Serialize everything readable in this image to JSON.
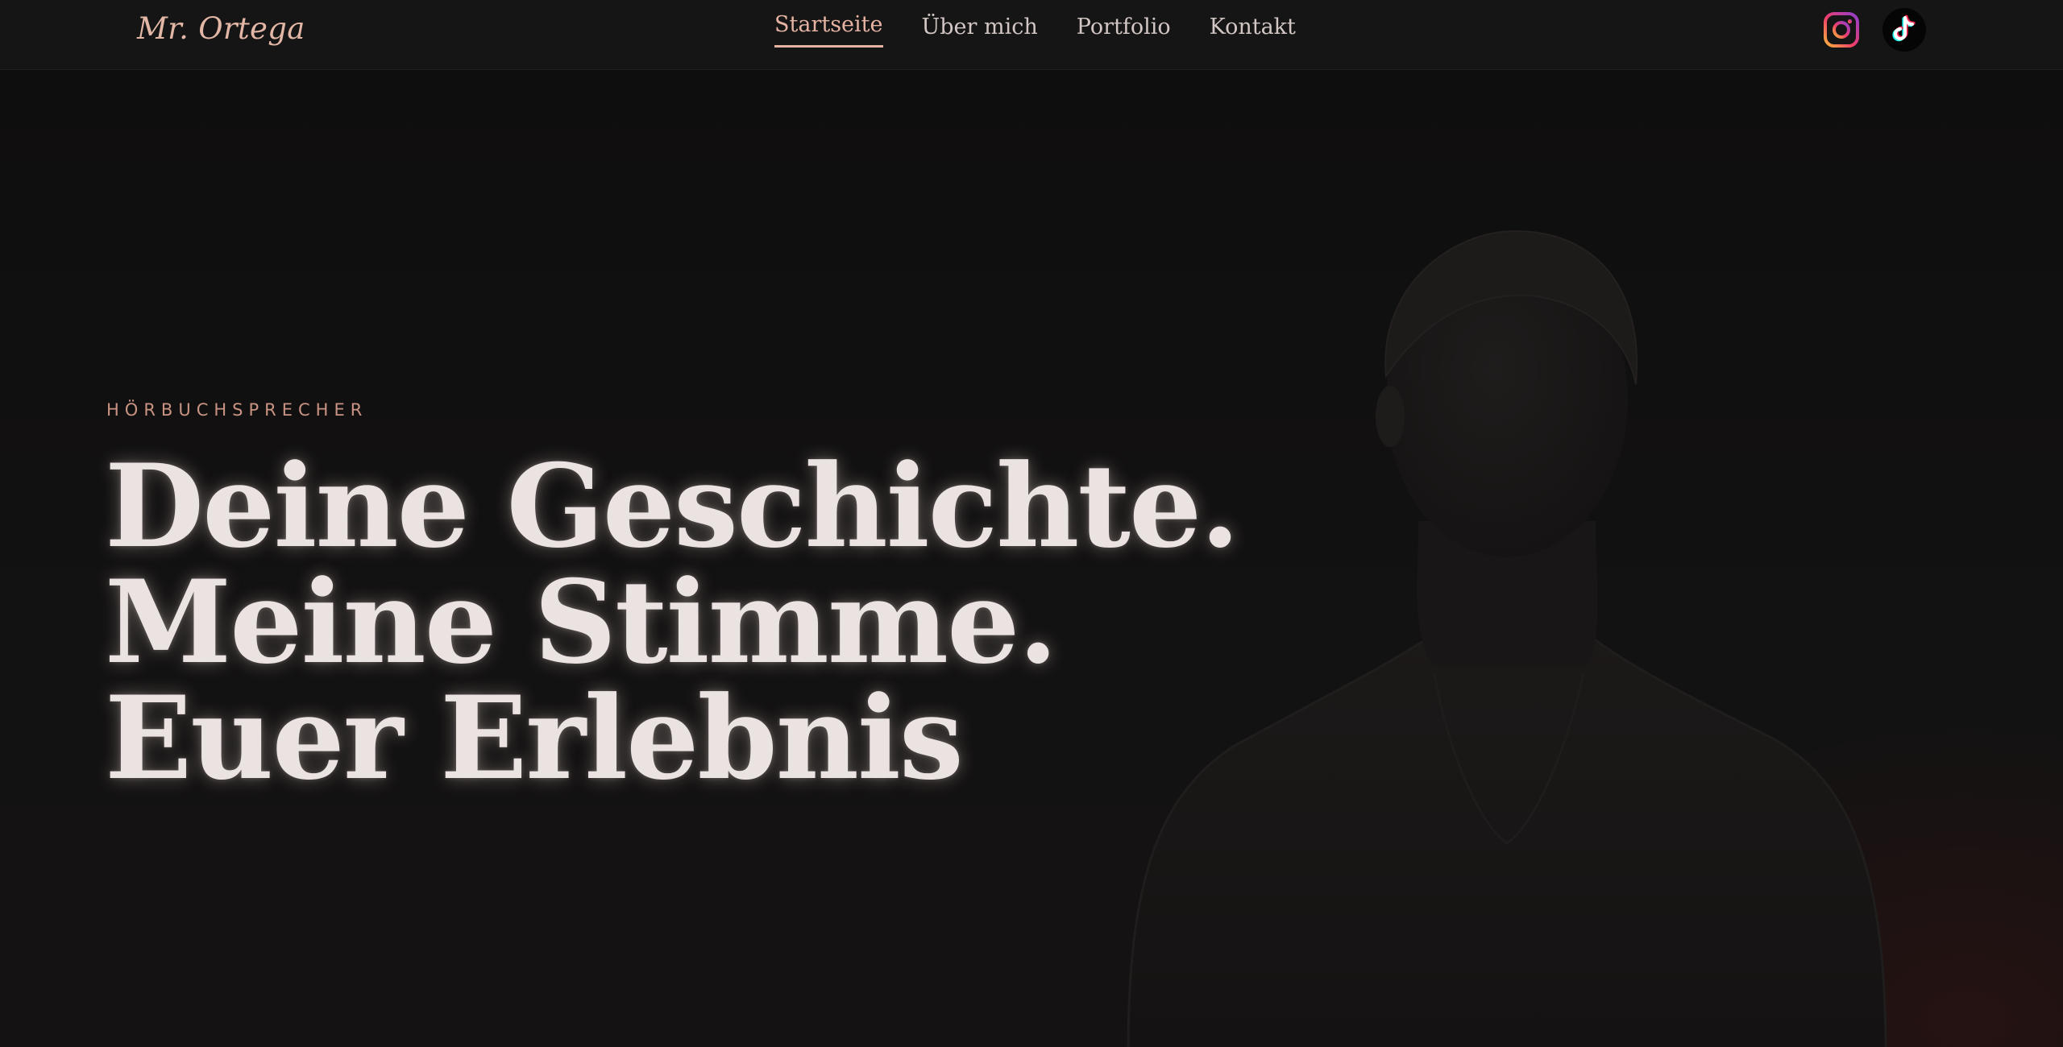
{
  "header": {
    "logo_text": "Mr. Ortega",
    "nav": [
      {
        "label": "Startseite",
        "active": true
      },
      {
        "label": "Über mich",
        "active": false
      },
      {
        "label": "Portfolio",
        "active": false
      },
      {
        "label": "Kontakt",
        "active": false
      }
    ],
    "social": [
      {
        "name": "instagram-icon"
      },
      {
        "name": "tiktok-icon"
      }
    ]
  },
  "hero": {
    "eyebrow": "HÖRBUCHSPRECHER",
    "headline_lines": [
      "Deine Geschichte.",
      "Meine Stimme.",
      "Euer Erlebnis"
    ]
  },
  "colors": {
    "accent": "#e6b3a3",
    "background": "#121111",
    "headline": "#ebe3e1"
  }
}
